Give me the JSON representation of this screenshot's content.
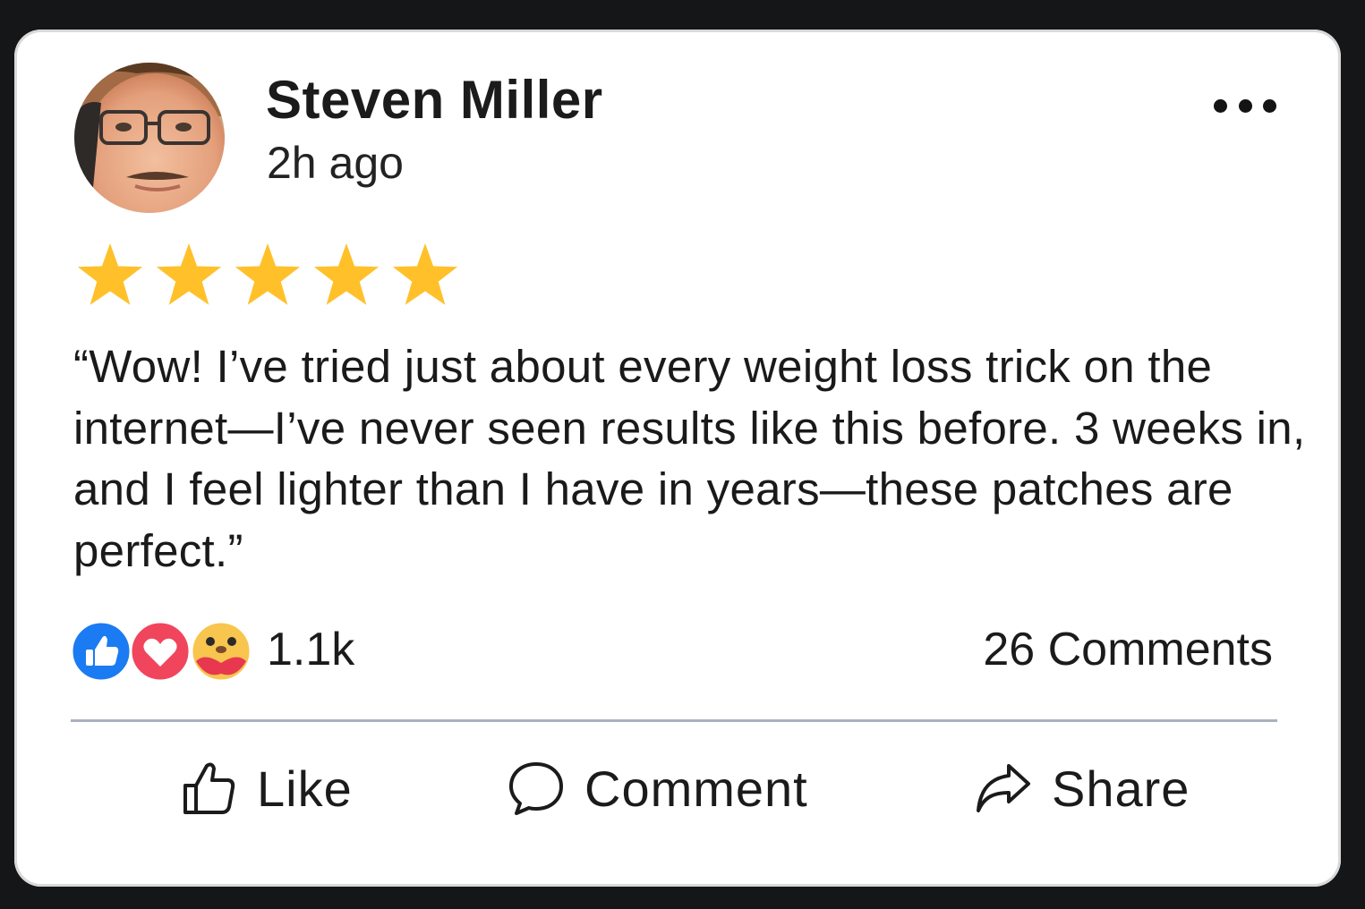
{
  "post": {
    "author": "Steven Miller",
    "time": "2h ago",
    "rating": 5,
    "rating_max": 5,
    "review_text": "“Wow! I’ve tried just about every weight loss trick on the internet—I’ve never seen results like this before. 3 weeks in, and I feel lighter than I have in years—these patches are perfect.”"
  },
  "stats": {
    "reactions_count": "1.1k",
    "comments_count": "26 Comments",
    "reactions": [
      "like-icon",
      "love-icon",
      "care-icon"
    ]
  },
  "actions": {
    "like_label": "Like",
    "comment_label": "Comment",
    "share_label": "Share"
  },
  "icons": {
    "more": "more-options-icon",
    "like": "thumbs-up-icon",
    "comment": "speech-bubble-icon",
    "share": "share-arrow-icon"
  },
  "colors": {
    "star": "#FFC02A",
    "like_blue": "#1B7BF2",
    "love_red": "#F0455C",
    "care_yellow": "#F8C54E",
    "divider": "#AAB0BD"
  }
}
